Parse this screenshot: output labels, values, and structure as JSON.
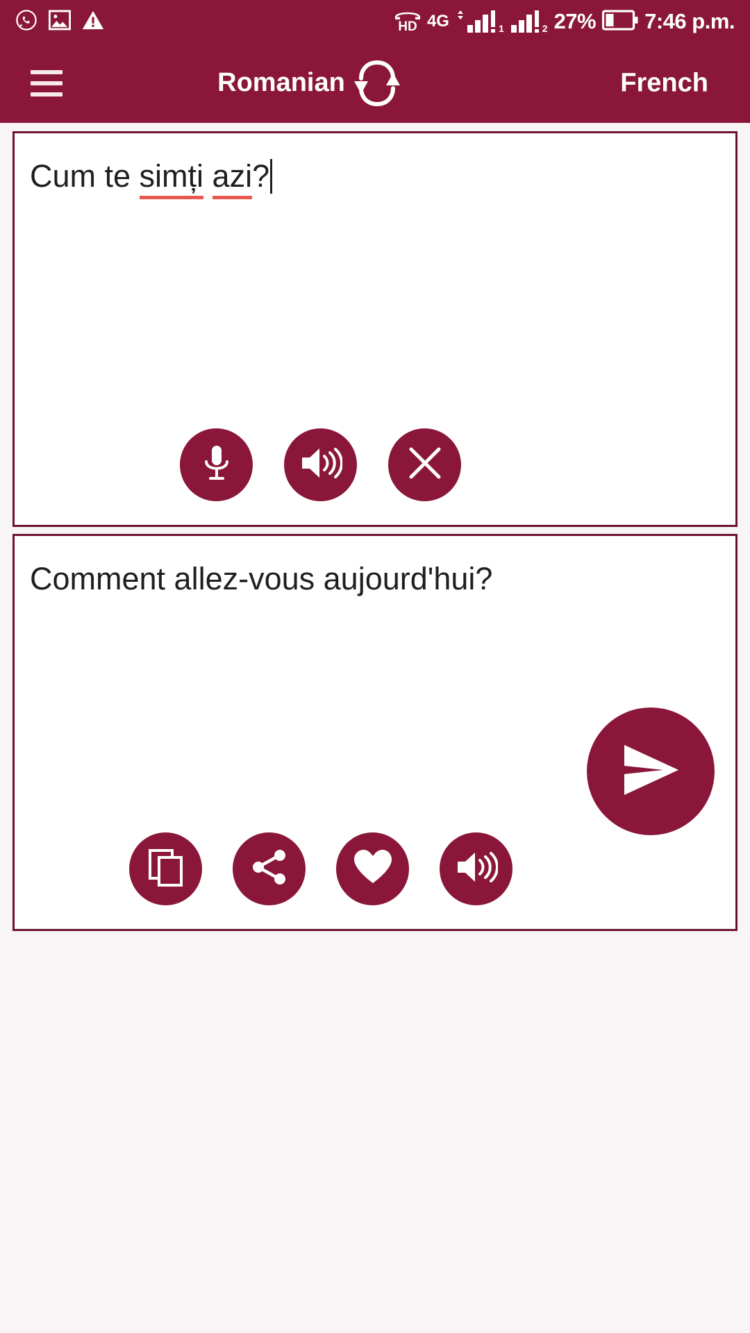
{
  "colors": {
    "brand": "#8a1739",
    "panel_border": "#6e1230",
    "spellcheck_underline": "#e8594f",
    "page_background": "#f7f5f6",
    "on_brand_text": "#ffffff"
  },
  "status_bar": {
    "left_icons": [
      {
        "name": "whatsapp-icon",
        "glyph": "whatsapp"
      },
      {
        "name": "image-icon",
        "glyph": "image"
      },
      {
        "name": "warning-icon",
        "glyph": "warning"
      }
    ],
    "volte_label": "HD",
    "network_type": "4G",
    "sim1_label": "1",
    "sim2_label": "2",
    "battery_percent": "27%",
    "clock": "7:46 p.m."
  },
  "app_bar": {
    "menu_label": "Menu",
    "source_language": "Romanian",
    "swap_label": "Swap languages",
    "target_language": "French"
  },
  "source_panel": {
    "text_prefix": "Cum te ",
    "misspelled_word_1": "simți",
    "text_middle": " ",
    "misspelled_word_2": "azi",
    "text_suffix": "?",
    "full_text": "Cum te simți azi?",
    "buttons": [
      {
        "name": "microphone-button",
        "icon": "microphone-icon",
        "label": "Voice input"
      },
      {
        "name": "speak-source-button",
        "icon": "speaker-icon",
        "label": "Listen"
      },
      {
        "name": "clear-button",
        "icon": "close-icon",
        "label": "Clear"
      }
    ]
  },
  "send_button": {
    "name": "send-button",
    "icon": "send-icon",
    "label": "Translate"
  },
  "target_panel": {
    "text": "Comment allez-vous aujourd'hui?",
    "buttons": [
      {
        "name": "copy-button",
        "icon": "copy-icon",
        "label": "Copy"
      },
      {
        "name": "share-button",
        "icon": "share-icon",
        "label": "Share"
      },
      {
        "name": "favorite-button",
        "icon": "heart-icon",
        "label": "Favorite"
      },
      {
        "name": "speak-target-button",
        "icon": "speaker-icon",
        "label": "Listen"
      }
    ]
  }
}
